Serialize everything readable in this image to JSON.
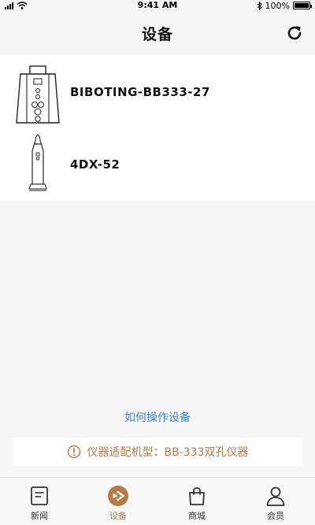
{
  "status_bar": {
    "time": "9:41 AM",
    "battery": "100%",
    "battery_level": 1.0
  },
  "header": {
    "title": "设备",
    "refresh_icon": "refresh-icon"
  },
  "devices": [
    {
      "name": "BIBOTING-BB333-27",
      "icon": "desktop-device-icon"
    },
    {
      "name": "4DX-52",
      "icon": "handheld-device-icon"
    }
  ],
  "help_link": "如何操作设备",
  "notice": {
    "icon": "warning-circle-icon",
    "text": "仪器适配机型：BB-333双孔仪器"
  },
  "tabs": [
    {
      "label": "新闻",
      "icon": "news-icon",
      "active": false
    },
    {
      "label": "设备",
      "icon": "device-icon",
      "active": true
    },
    {
      "label": "商城",
      "icon": "shopping-bag-icon",
      "active": false
    },
    {
      "label": "会员",
      "icon": "user-icon",
      "active": false
    }
  ],
  "colors": {
    "accent": "#b77a45",
    "link": "#3b7fd6",
    "background": "#f6f6f6"
  }
}
